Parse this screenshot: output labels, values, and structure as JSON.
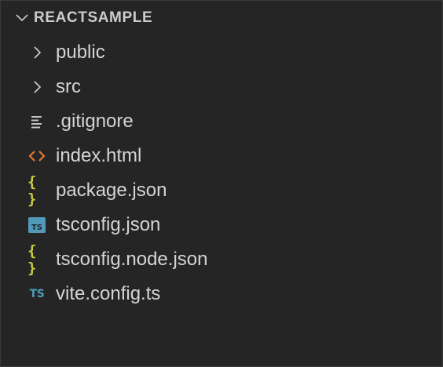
{
  "explorer": {
    "title": "REACTSAMPLE",
    "expanded": true
  },
  "items": [
    {
      "label": "public",
      "kind": "folder",
      "icon": "chevron-right-icon"
    },
    {
      "label": "src",
      "kind": "folder",
      "icon": "chevron-right-icon"
    },
    {
      "label": ".gitignore",
      "kind": "file",
      "icon": "lines-icon"
    },
    {
      "label": "index.html",
      "kind": "file",
      "icon": "html-icon"
    },
    {
      "label": "package.json",
      "kind": "file",
      "icon": "json-icon"
    },
    {
      "label": "tsconfig.json",
      "kind": "file",
      "icon": "tsconfig-icon"
    },
    {
      "label": "tsconfig.node.json",
      "kind": "file",
      "icon": "json-icon"
    },
    {
      "label": "vite.config.ts",
      "kind": "file",
      "icon": "typescript-icon"
    }
  ],
  "icon_labels": {
    "tsconfig": "TS",
    "typescript": "TS",
    "json": "{ }"
  },
  "colors": {
    "background": "#252526",
    "text": "#d4d4d4",
    "chevron": "#c5c5c5",
    "html_icon": "#e37933",
    "json_icon": "#cbcb41",
    "ts_icon": "#519aba"
  }
}
